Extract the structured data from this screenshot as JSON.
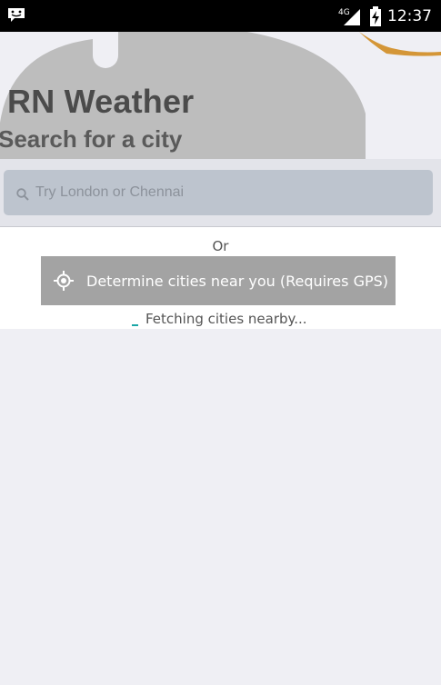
{
  "status_bar": {
    "network": "4G",
    "time": "12:37",
    "notification_icon": "chat-notification-icon",
    "signal_icon": "signal-icon",
    "battery_icon": "battery-charging-icon"
  },
  "header": {
    "app_title": "RN Weather",
    "search_heading": "Search for a city"
  },
  "search": {
    "placeholder": "Try London or Chennai",
    "value": "",
    "icon": "search-icon"
  },
  "location": {
    "or_label": "Or",
    "button_label": "Determine cities near you (Requires GPS)",
    "button_icon": "gps-locate-icon",
    "status_text": "Fetching cities nearby..."
  },
  "colors": {
    "status_bar_bg": "#000000",
    "accent_spinner": "#1aa6a6",
    "button_bg": "#a3a3a3",
    "search_box_bg": "#bdc4ce",
    "page_bg": "#efeff4"
  }
}
